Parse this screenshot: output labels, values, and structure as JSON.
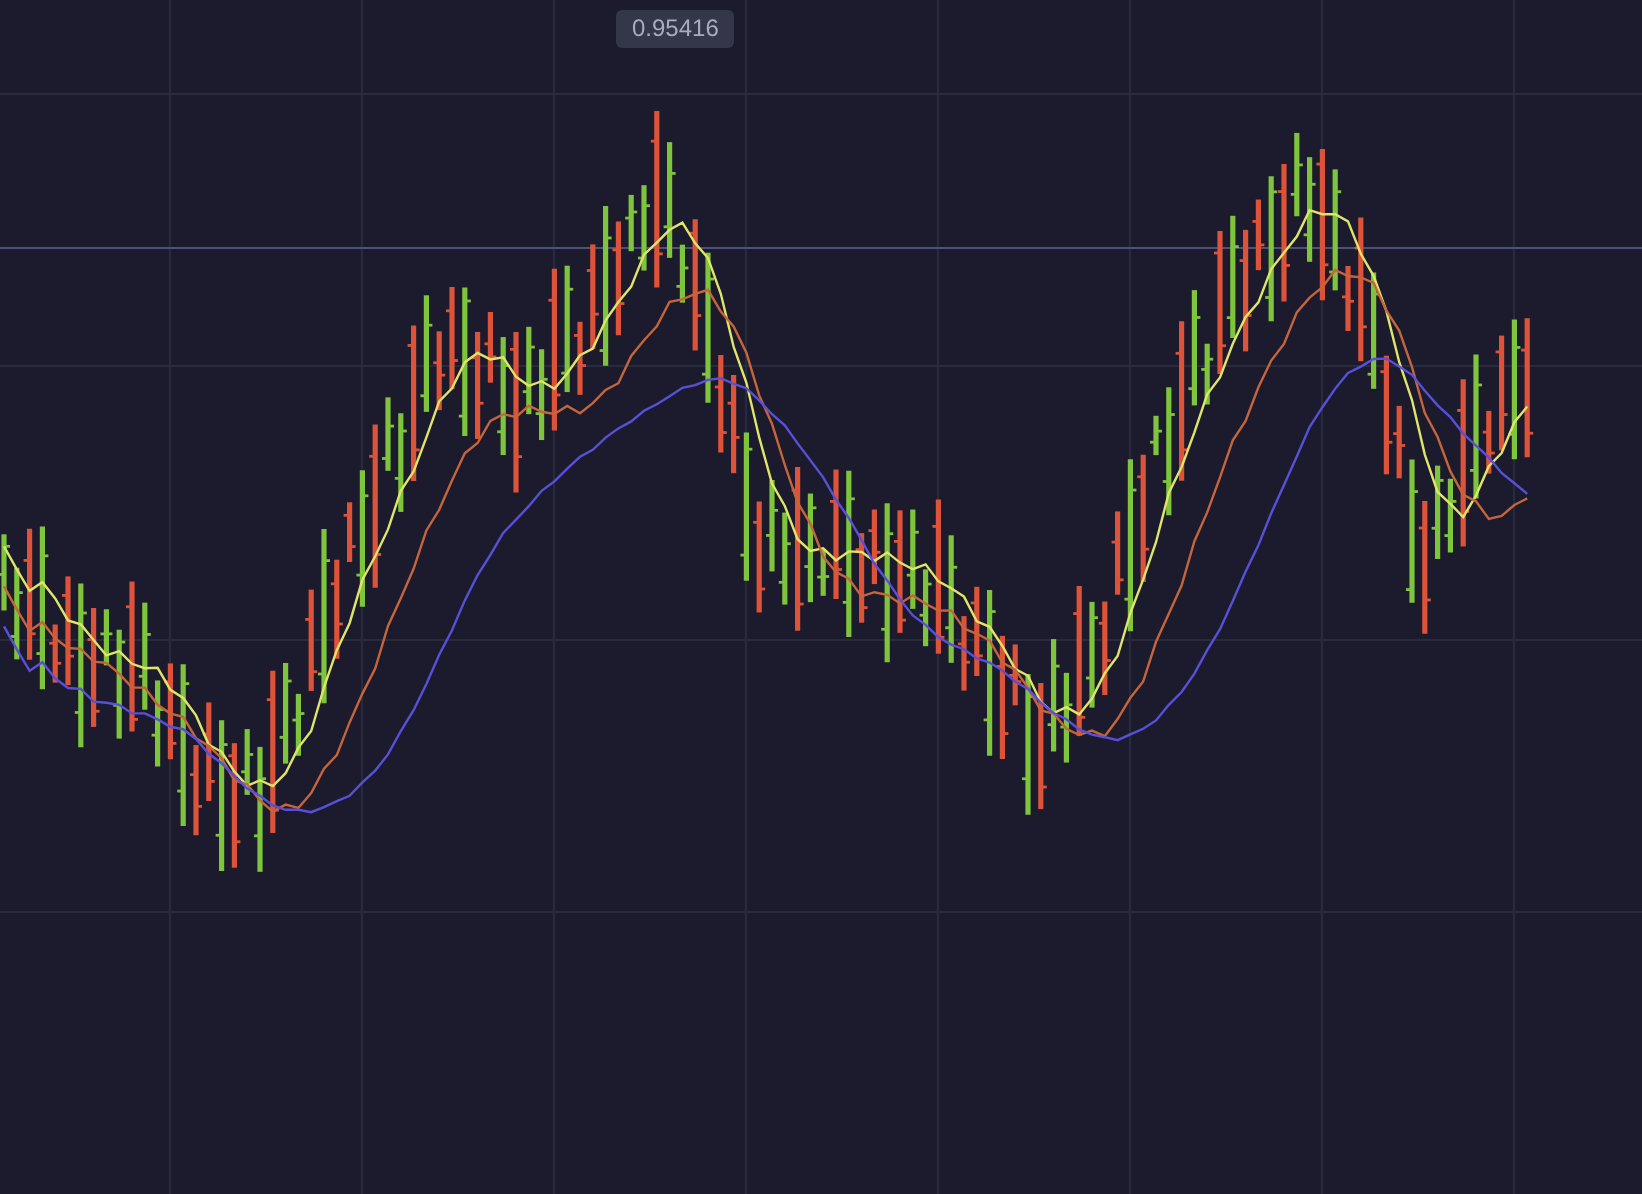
{
  "price_label": "0.95416"
}
